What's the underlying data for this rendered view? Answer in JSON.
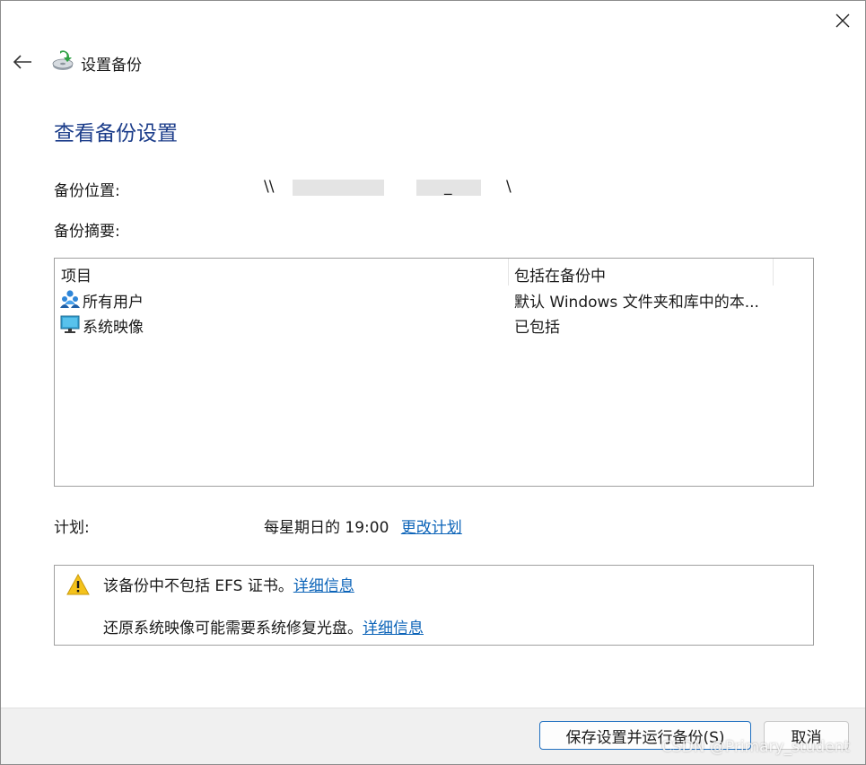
{
  "window": {
    "title": "设置备份",
    "close_label": "×"
  },
  "page": {
    "heading": "查看备份设置"
  },
  "location": {
    "label": "备份位置:",
    "prefix": "\\\\",
    "sep": "_",
    "suffix": "\\"
  },
  "summary": {
    "label": "备份摘要:",
    "columns": [
      "项目",
      "包括在备份中"
    ],
    "rows": [
      {
        "icon": "users-icon",
        "name": "所有用户",
        "value": "默认 Windows 文件夹和库中的本..."
      },
      {
        "icon": "monitor-icon",
        "name": "系统映像",
        "value": "已包括"
      }
    ]
  },
  "schedule": {
    "label": "计划:",
    "value": "每星期日的 19:00",
    "change_link": "更改计划"
  },
  "notices": [
    {
      "text": "该备份中不包括 EFS 证书。",
      "link": "详细信息"
    },
    {
      "text": "还原系统映像可能需要系统修复光盘。",
      "link": "详细信息"
    }
  ],
  "buttons": {
    "save_run": "保存设置并运行备份(S)",
    "cancel": "取消"
  },
  "watermark": "CSDN @Primary_student",
  "colors": {
    "heading": "#1c3d8a",
    "link": "#0b63b8",
    "primary_border": "#1f6fc0",
    "footer": "#f0f0f0"
  }
}
